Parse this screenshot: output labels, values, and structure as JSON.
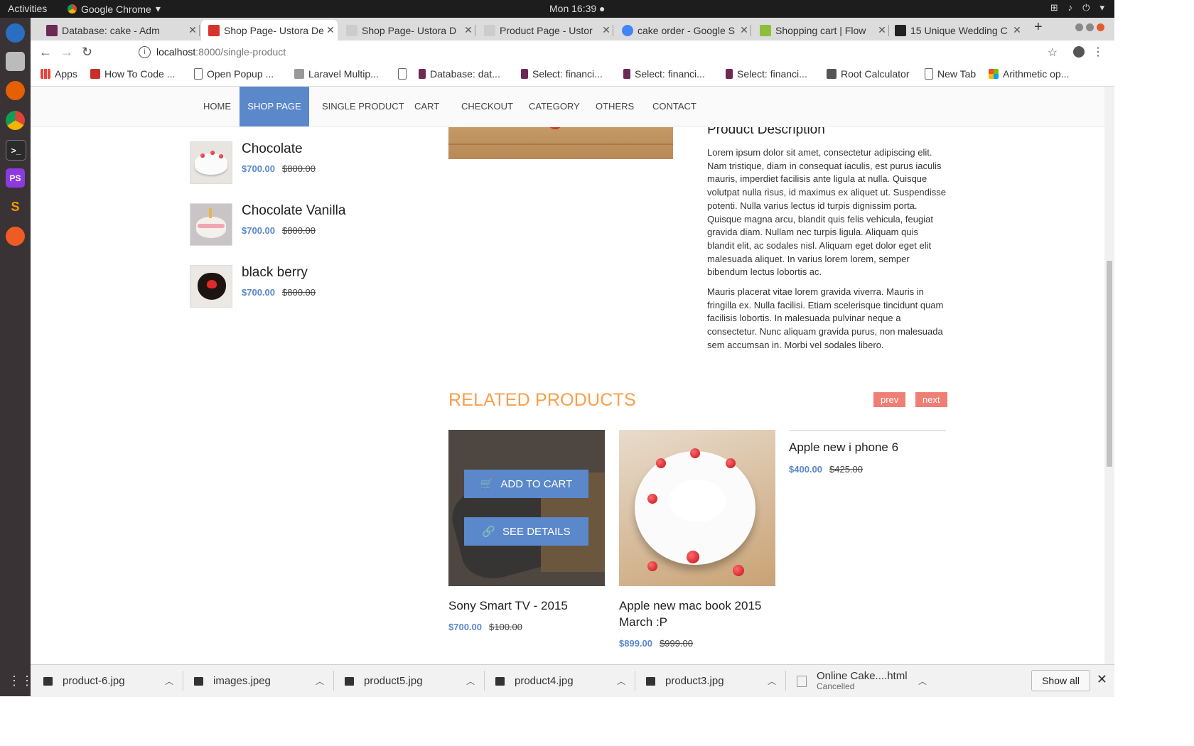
{
  "os": {
    "activities": "Activities",
    "app_name": "Google Chrome",
    "clock": "Mon 16:39"
  },
  "browser": {
    "tabs": [
      {
        "title": "Database: cake - Adm",
        "fav_color": "#6c2a55"
      },
      {
        "title": "Shop Page- Ustora De",
        "fav_color": "#d9342b"
      },
      {
        "title": "Shop Page- Ustora D",
        "fav_color": "#cccccc"
      },
      {
        "title": "Product Page - Ustor",
        "fav_color": "#cccccc"
      },
      {
        "title": "cake order - Google S",
        "fav_color": "#4285f4"
      },
      {
        "title": "Shopping cart | Flow",
        "fav_color": "#8dbf3a"
      },
      {
        "title": "15 Unique Wedding C",
        "fav_color": "#222222"
      }
    ],
    "url_host": "localhost",
    "url_path": ":8000/single-product",
    "bookmarks": [
      {
        "label": "Apps",
        "color": "#e8453c"
      },
      {
        "label": "How To Code ...",
        "color": "#c9302c"
      },
      {
        "label": "Open Popup ...",
        "color": "#ffffff"
      },
      {
        "label": "Laravel Multip...",
        "color": "#999999"
      },
      {
        "label": "",
        "color": "#ffffff"
      },
      {
        "label": "Database: dat...",
        "color": "#6c2a55"
      },
      {
        "label": "Select: financi...",
        "color": "#6c2a55"
      },
      {
        "label": "Select: financi...",
        "color": "#6c2a55"
      },
      {
        "label": "Select: financi...",
        "color": "#6c2a55"
      },
      {
        "label": "Root Calculator",
        "color": "#555555"
      },
      {
        "label": "New Tab",
        "color": "#ffffff"
      },
      {
        "label": "Arithmetic op...",
        "color": "#f25022"
      }
    ]
  },
  "nav": {
    "items": [
      "Home",
      "Shop page",
      "Single product",
      "Cart",
      "Checkout",
      "Category",
      "Others",
      "Contact"
    ],
    "active_index": 1,
    "accent": "#5a88ca"
  },
  "sidebar_products": [
    {
      "name": "Chocolate",
      "price": "$700.00",
      "old_price": "$800.00"
    },
    {
      "name": "Chocolate Vanilla",
      "price": "$700.00",
      "old_price": "$800.00"
    },
    {
      "name": "black berry",
      "price": "$700.00",
      "old_price": "$800.00"
    }
  ],
  "description": {
    "title": "Product Description",
    "paragraphs": [
      "Lorem ipsum dolor sit amet, consectetur adipiscing elit. Nam tristique, diam in consequat iaculis, est purus iaculis mauris, imperdiet facilisis ante ligula at nulla. Quisque volutpat nulla risus, id maximus ex aliquet ut. Suspendisse potenti. Nulla varius lectus id turpis dignissim porta. Quisque magna arcu, blandit quis felis vehicula, feugiat gravida diam. Nullam nec turpis ligula. Aliquam quis blandit elit, ac sodales nisl. Aliquam eget dolor eget elit malesuada aliquet. In varius lorem lorem, semper bibendum lectus lobortis ac.",
      "Mauris placerat vitae lorem gravida viverra. Mauris in fringilla ex. Nulla facilisi. Etiam scelerisque tincidunt quam facilisis lobortis. In malesuada pulvinar neque a consectetur. Nunc aliquam gravida purus, non malesuada sem accumsan in. Morbi vel sodales libero."
    ]
  },
  "related": {
    "title": "RELATED PRODUCTS",
    "prev": "prev",
    "next": "next",
    "add_to_cart": "Add to cart",
    "see_details": "See details",
    "products": [
      {
        "name": "Sony Smart TV - 2015",
        "price": "$700.00",
        "old_price": "$100.00"
      },
      {
        "name": "Apple new mac book 2015 March :P",
        "price": "$899.00",
        "old_price": "$999.00"
      },
      {
        "name": "Apple new i phone 6",
        "price": "$400.00",
        "old_price": "$425.00"
      }
    ]
  },
  "downloads": {
    "items": [
      "product-6.jpg",
      "images.jpeg",
      "product5.jpg",
      "product4.jpg",
      "product3.jpg"
    ],
    "last_item": {
      "name": "Online Cake....html",
      "status": "Cancelled"
    },
    "show_all": "Show all"
  }
}
